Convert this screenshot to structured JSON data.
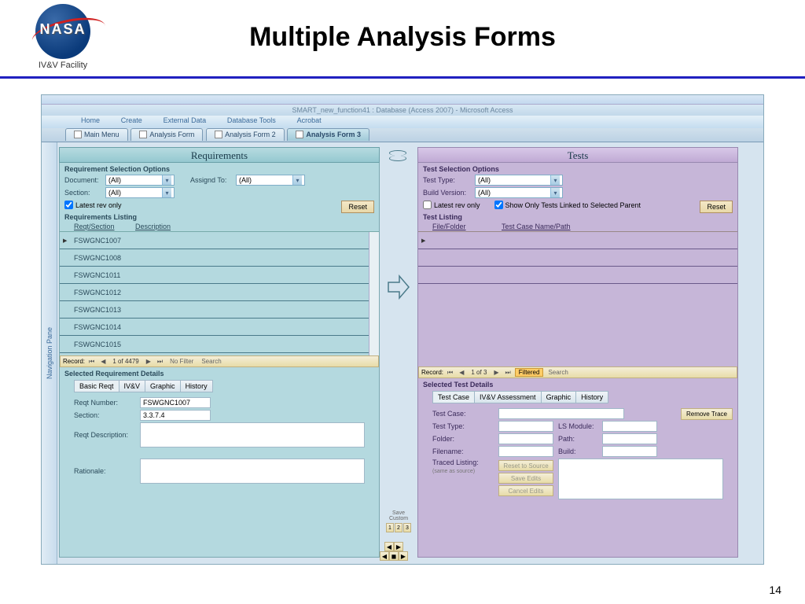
{
  "slide": {
    "facility": "IV&V Facility",
    "title": "Multiple Analysis Forms",
    "page_num": "14"
  },
  "app": {
    "title": "SMART_new_function41 : Database (Access 2007) - Microsoft Access",
    "ribbon_tabs": [
      "Home",
      "Create",
      "External Data",
      "Database Tools",
      "Acrobat"
    ],
    "form_tabs": [
      "Main Menu",
      "Analysis Form",
      "Analysis Form 2",
      "Analysis Form 3"
    ],
    "nav_pane": "Navigation Pane"
  },
  "reqs": {
    "title": "Requirements",
    "opts_label": "Requirement Selection Options",
    "document_label": "Document:",
    "document_val": "(All)",
    "assigned_label": "Assignd To:",
    "assigned_val": "(All)",
    "section_label": "Section:",
    "section_val": "(All)",
    "latest_rev": "Latest rev only",
    "reset": "Reset",
    "listing_label": "Requirements Listing",
    "col1": "Reqt/Section",
    "col2": "Description",
    "rows": [
      "FSWGNC1007",
      "FSWGNC1008",
      "FSWGNC1011",
      "FSWGNC1012",
      "FSWGNC1013",
      "FSWGNC1014",
      "FSWGNC1015"
    ],
    "rec_info": "1 of 4479",
    "rec_label": "Record:",
    "nofilter": "No Filter",
    "search": "Search",
    "details_label": "Selected Requirement Details",
    "tabs": [
      "Basic Reqt",
      "IV&V",
      "Graphic",
      "History"
    ],
    "reqt_num_label": "Reqt Number:",
    "reqt_num_val": "FSWGNC1007",
    "sect_label": "Section:",
    "sect_val": "3.3.7.4",
    "desc_label": "Reqt Description:",
    "rationale_label": "Rationale:"
  },
  "tests": {
    "title": "Tests",
    "opts_label": "Test Selection Options",
    "type_label": "Test Type:",
    "type_val": "(All)",
    "build_label": "Build Version:",
    "build_val": "(All)",
    "latest_rev": "Latest rev only",
    "show_linked": "Show Only Tests Linked to Selected Parent",
    "reset": "Reset",
    "listing_label": "Test Listing",
    "col1": "File/Folder",
    "col2": "Test Case Name/Path",
    "rec_info": "1 of 3",
    "rec_label": "Record:",
    "filtered": "Filtered",
    "search": "Search",
    "details_label": "Selected Test Details",
    "tabs": [
      "Test Case",
      "IV&V Assessment",
      "Graphic",
      "History"
    ],
    "tc_label": "Test Case:",
    "remove_trace": "Remove Trace",
    "ttype_label": "Test Type:",
    "ls_label": "LS Module:",
    "folder_label": "Folder:",
    "path_label": "Path:",
    "filename_label": "Filename:",
    "tbuild_label": "Build:",
    "traced_label": "Traced Listing:",
    "traced_note": "(same as source)",
    "btn_reset": "Reset to Source",
    "btn_save": "Save Edits",
    "btn_cancel": "Cancel Edits"
  },
  "center": {
    "save_custom": "Save Custom",
    "btns": [
      "1",
      "2",
      "3"
    ]
  }
}
